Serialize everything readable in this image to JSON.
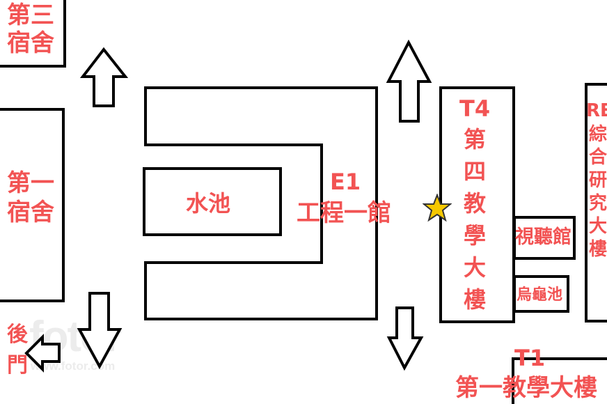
{
  "map": {
    "buildings": {
      "dorm3": {
        "line1": "第三",
        "line2": "宿舍"
      },
      "dorm1": {
        "line1": "第一",
        "line2": "宿舍"
      },
      "pond": {
        "label": "水池"
      },
      "e1": {
        "code": "E1",
        "name": "工程一館"
      },
      "t4": {
        "code": "T4",
        "chars": [
          "第",
          "四",
          "教",
          "學",
          "大",
          "樓"
        ]
      },
      "av_hall": {
        "label": "視聽館"
      },
      "turtle_pond": {
        "label": "烏龜池"
      },
      "re": {
        "code": "RE",
        "chars": [
          "綜",
          "合",
          "研",
          "究",
          "大",
          "樓"
        ]
      },
      "t1": {
        "code": "T1",
        "name": "第一教學大樓"
      },
      "back_gate": {
        "line1": "後",
        "line2": "門"
      }
    },
    "marker": {
      "icon": "star-icon",
      "color": "#f5c800"
    },
    "accent_color": "#f25353"
  },
  "watermark": {
    "logo": "fotor",
    "url": "www.fotor.com"
  }
}
